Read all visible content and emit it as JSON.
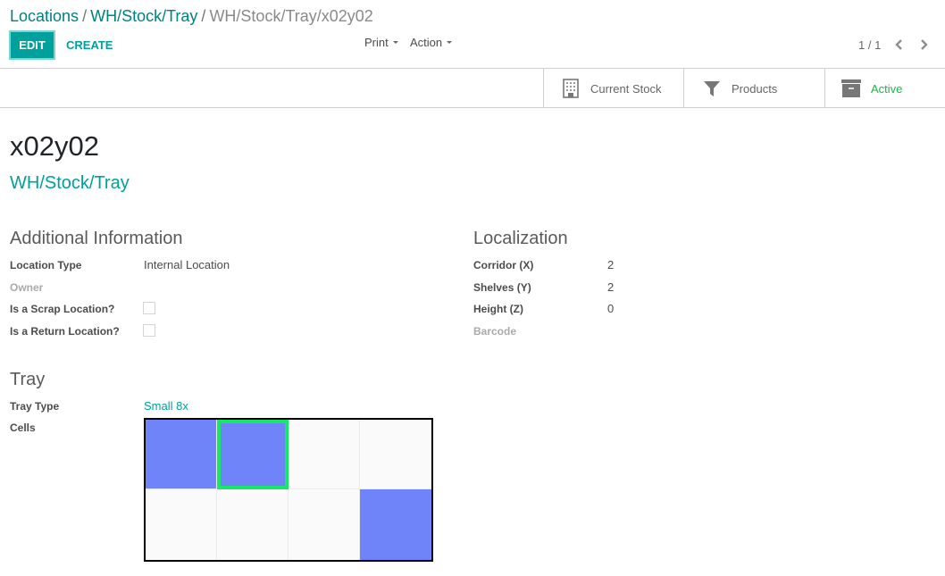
{
  "breadcrumb": {
    "items": [
      "Locations",
      "WH/Stock/Tray"
    ],
    "separator": "/",
    "current": "WH/Stock/Tray/x02y02"
  },
  "toolbar": {
    "edit_label": "EDIT",
    "create_label": "CREATE",
    "print_label": "Print",
    "action_label": "Action"
  },
  "pager": {
    "value": "1 / 1",
    "prev_icon": "chevron-left-icon",
    "next_icon": "chevron-right-icon"
  },
  "button_box": [
    {
      "label": "Current Stock",
      "icon": "building-icon"
    },
    {
      "label": "Products",
      "icon": "filter-icon"
    },
    {
      "label": "Active",
      "icon": "archive-icon",
      "color": "#21b14b"
    }
  ],
  "record": {
    "name": "x02y02",
    "parent": "WH/Stock/Tray"
  },
  "additional_info": {
    "title": "Additional Information",
    "fields": [
      {
        "label": "Location Type",
        "value": "Internal Location"
      },
      {
        "label": "Owner",
        "value": ""
      },
      {
        "label": "Is a Scrap Location?",
        "checked": false
      },
      {
        "label": "Is a Return Location?",
        "checked": false
      }
    ]
  },
  "localization": {
    "title": "Localization",
    "fields": [
      {
        "label": "Corridor (X)",
        "value": "2"
      },
      {
        "label": "Shelves (Y)",
        "value": "2"
      },
      {
        "label": "Height (Z)",
        "value": "0"
      },
      {
        "label": "Barcode",
        "value": ""
      }
    ]
  },
  "tray": {
    "title": "Tray",
    "tray_type_label": "Tray Type",
    "tray_type_value": "Small 8x",
    "cells_label": "Cells",
    "cols": 4,
    "rows": 2,
    "cells": [
      [
        true,
        true,
        false,
        false
      ],
      [
        false,
        false,
        false,
        true
      ]
    ],
    "selected": {
      "row": 0,
      "col": 1
    },
    "colors": {
      "filled": "#6e84f8",
      "empty": "#fafafa",
      "selected_border": "#14e868"
    }
  },
  "colors": {
    "primary": "#00a09d",
    "link": "#00827f",
    "active": "#21b14b"
  }
}
